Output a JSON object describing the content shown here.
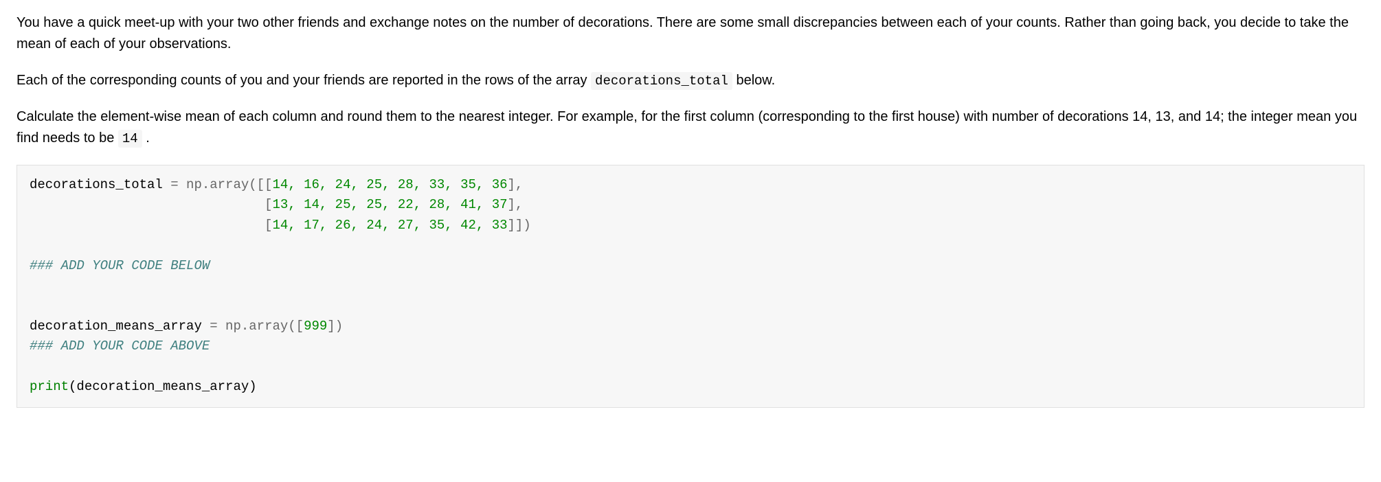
{
  "paragraphs": {
    "p1": "You have a quick meet-up with your two other friends and exchange notes on the number of decorations. There are some small discrepancies between each of your counts. Rather than going back, you decide to take the mean of each of your observations.",
    "p2_before": "Each of the corresponding counts of you and your friends are reported in the rows of the array ",
    "p2_code": "decorations_total",
    "p2_after": " below.",
    "p3_before": "Calculate the element-wise mean of each column and round them to the nearest integer. For example, for the first column (corresponding to the first house) with number of decorations 14, 13, and 14; the integer mean you find needs to be ",
    "p3_code": "14",
    "p3_after": " ."
  },
  "code": {
    "l1_var": "decorations_total ",
    "l1_assign": "= np.array([[",
    "l1_nums": "14, 16, 24, 25, 28, 33, 35, 36",
    "l1_end": "],",
    "l2_pad": "                              [",
    "l2_nums": "13, 14, 25, 25, 22, 28, 41, 37",
    "l2_end": "],",
    "l3_pad": "                              [",
    "l3_nums": "14, 17, 26, 24, 27, 35, 42, 33",
    "l3_end": "]])",
    "comment_below": "### ADD YOUR CODE BELOW",
    "l4_var": "decoration_means_array ",
    "l4_assign": "= np.array([",
    "l4_num": "999",
    "l4_end": "])",
    "comment_above": "### ADD YOUR CODE ABOVE",
    "print_fn": "print",
    "print_arg": "(decoration_means_array)"
  },
  "chart_data": {
    "type": "table",
    "title": "decorations_total",
    "rows": [
      [
        14,
        16,
        24,
        25,
        28,
        33,
        35,
        36
      ],
      [
        13,
        14,
        25,
        25,
        22,
        28,
        41,
        37
      ],
      [
        14,
        17,
        26,
        24,
        27,
        35,
        42,
        33
      ]
    ],
    "placeholder_value": 999,
    "example_first_column_mean": 14
  }
}
